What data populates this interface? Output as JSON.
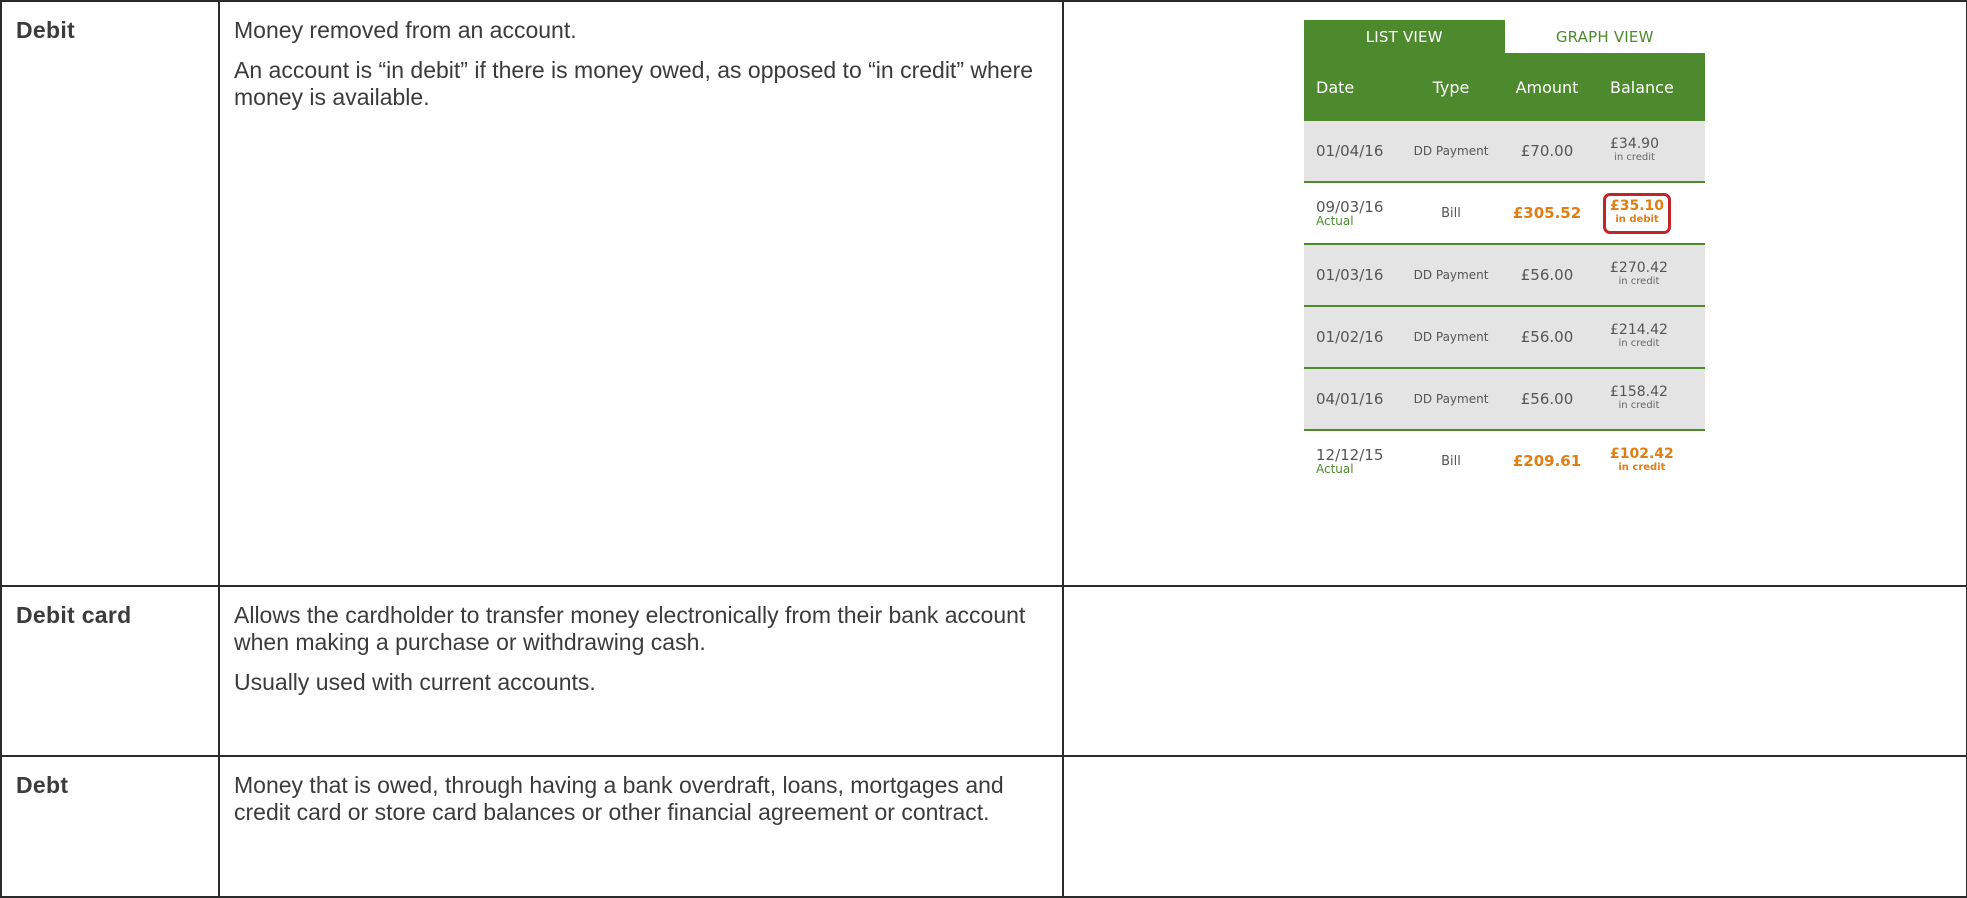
{
  "rows": [
    {
      "term": "Debit",
      "definition": [
        "Money removed from an account.",
        "An account is “in debit” if there is money owed, as opposed to “in credit” where money is available."
      ]
    },
    {
      "term": "Debit card",
      "definition": [
        "Allows the cardholder to transfer money electronically from their bank account when making a purchase or withdrawing cash.",
        "Usually used with current accounts."
      ]
    },
    {
      "term": "Debt",
      "definition": [
        "Money that is owed, through having a bank overdraft, loans, mortgages and credit card or store card balances or other financial agreement or contract."
      ]
    }
  ],
  "statement": {
    "tabs": [
      "LIST VIEW",
      "GRAPH VIEW"
    ],
    "columns": [
      "Date",
      "Type",
      "Amount",
      "Balance"
    ],
    "entries": [
      {
        "date": "01/04/16",
        "note": "",
        "type": "DD Payment",
        "amount": "£70.00",
        "balance": "£34.90",
        "status": "in credit"
      },
      {
        "date": "09/03/16",
        "note": "Actual",
        "type": "Bill",
        "amount": "£305.52",
        "balance": "£35.10",
        "status": "in debit"
      },
      {
        "date": "01/03/16",
        "note": "",
        "type": "DD Payment",
        "amount": "£56.00",
        "balance": "£270.42",
        "status": "in credit"
      },
      {
        "date": "01/02/16",
        "note": "",
        "type": "DD Payment",
        "amount": "£56.00",
        "balance": "£214.42",
        "status": "in credit"
      },
      {
        "date": "04/01/16",
        "note": "",
        "type": "DD Payment",
        "amount": "£56.00",
        "balance": "£158.42",
        "status": "in credit"
      },
      {
        "date": "12/12/15",
        "note": "Actual",
        "type": "Bill",
        "amount": "£209.61",
        "balance": "£102.42",
        "status": "in credit"
      }
    ],
    "colors": {
      "green": "#4c8a2d",
      "orange": "#e07e14",
      "highlight": "#c0252a"
    }
  }
}
